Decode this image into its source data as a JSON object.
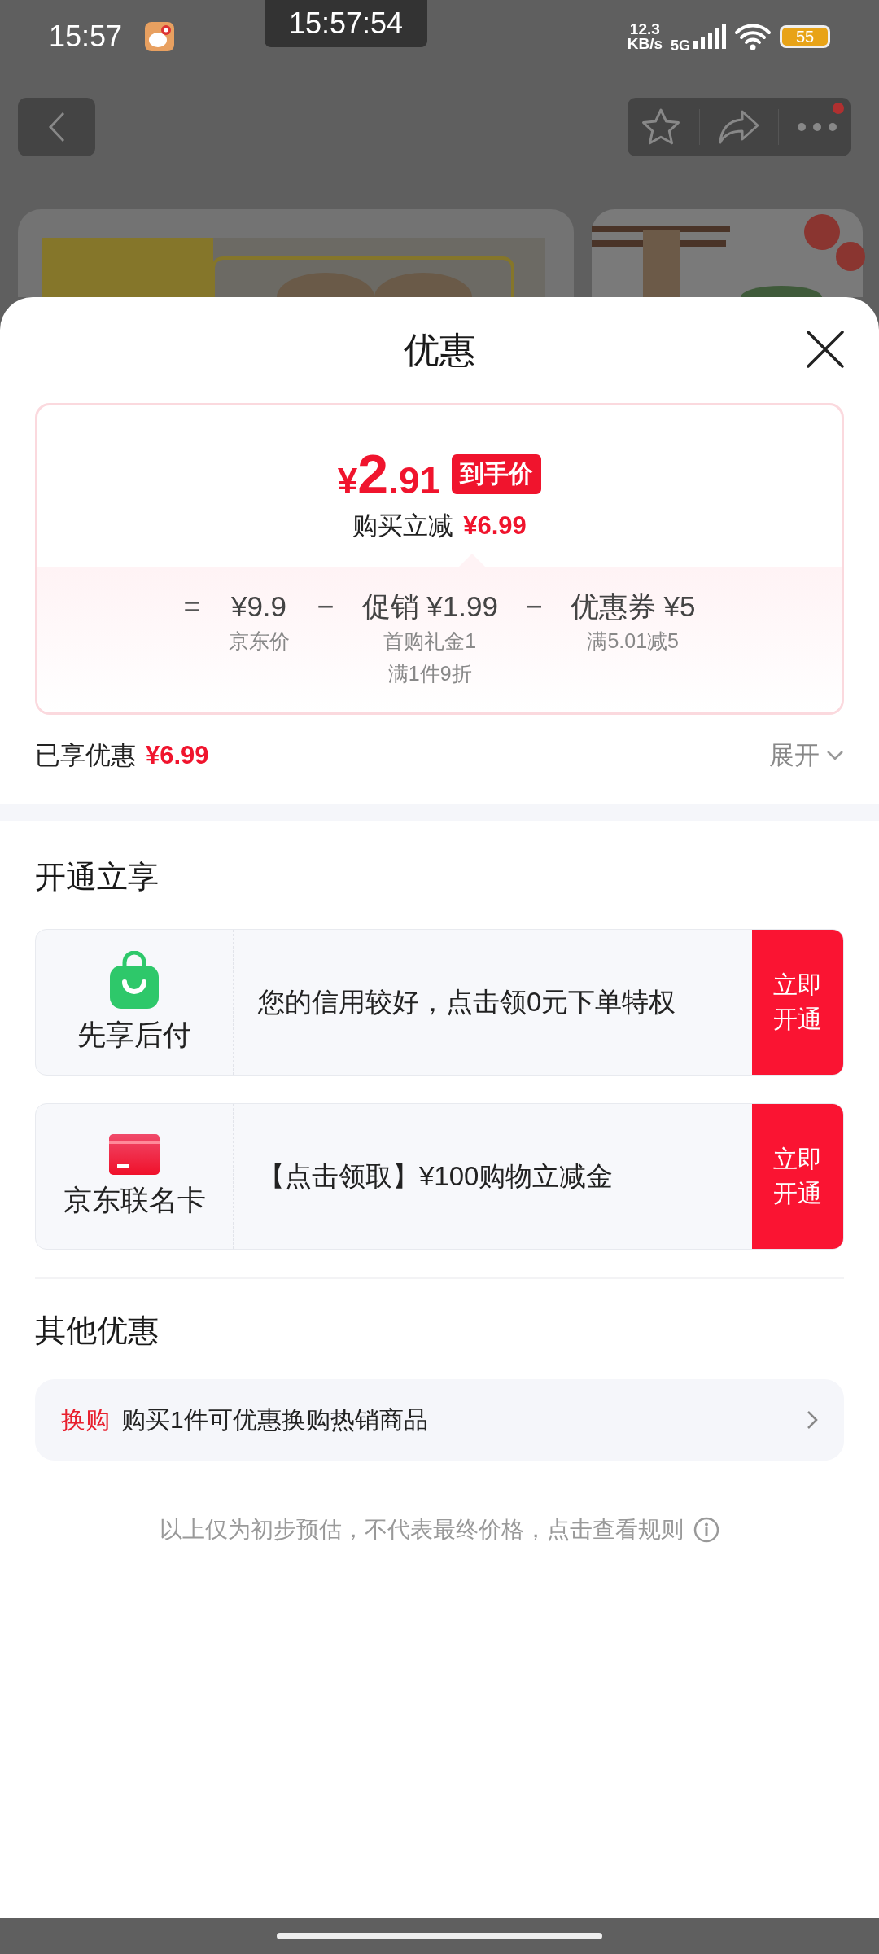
{
  "status_bar": {
    "time": "15:57",
    "clock_overlay": "15:57:54",
    "net_speed": "12.3",
    "net_unit": "KB/s",
    "network": "5G",
    "battery": "55"
  },
  "sheet": {
    "title": "优惠"
  },
  "price_card": {
    "currency": "¥",
    "price_int": "2",
    "price_dec": ".91",
    "price_tag": "到手价",
    "saving_label": "购买立减",
    "saving": "¥6.99",
    "breakdown": [
      {
        "op": "=",
        "amount": "¥9.9",
        "notes": [
          "京东价"
        ]
      },
      {
        "op": "−",
        "amount": "促销 ¥1.99",
        "notes": [
          "首购礼金1",
          "满1件9折"
        ]
      },
      {
        "op": "−",
        "amount": "优惠券 ¥5",
        "notes": [
          "满5.01减5"
        ]
      }
    ]
  },
  "summary": {
    "label": "已享优惠",
    "amount": "¥6.99",
    "toggle": "展开"
  },
  "open_section": {
    "title": "开通立享",
    "offers": [
      {
        "kind": "bag",
        "name": "先享后付",
        "text": "您的信用较好，点击领0元下单特权",
        "button": "立即开通"
      },
      {
        "kind": "card",
        "name": "京东联名卡",
        "text": "【点击领取】¥100购物立减金",
        "button": "立即开通"
      }
    ]
  },
  "other_section": {
    "title": "其他优惠",
    "items": [
      {
        "tag": "换购",
        "text": "购买1件可优惠换购热销商品"
      }
    ]
  },
  "footnote": "以上仅为初步预估，不代表最终价格，点击查看规则"
}
